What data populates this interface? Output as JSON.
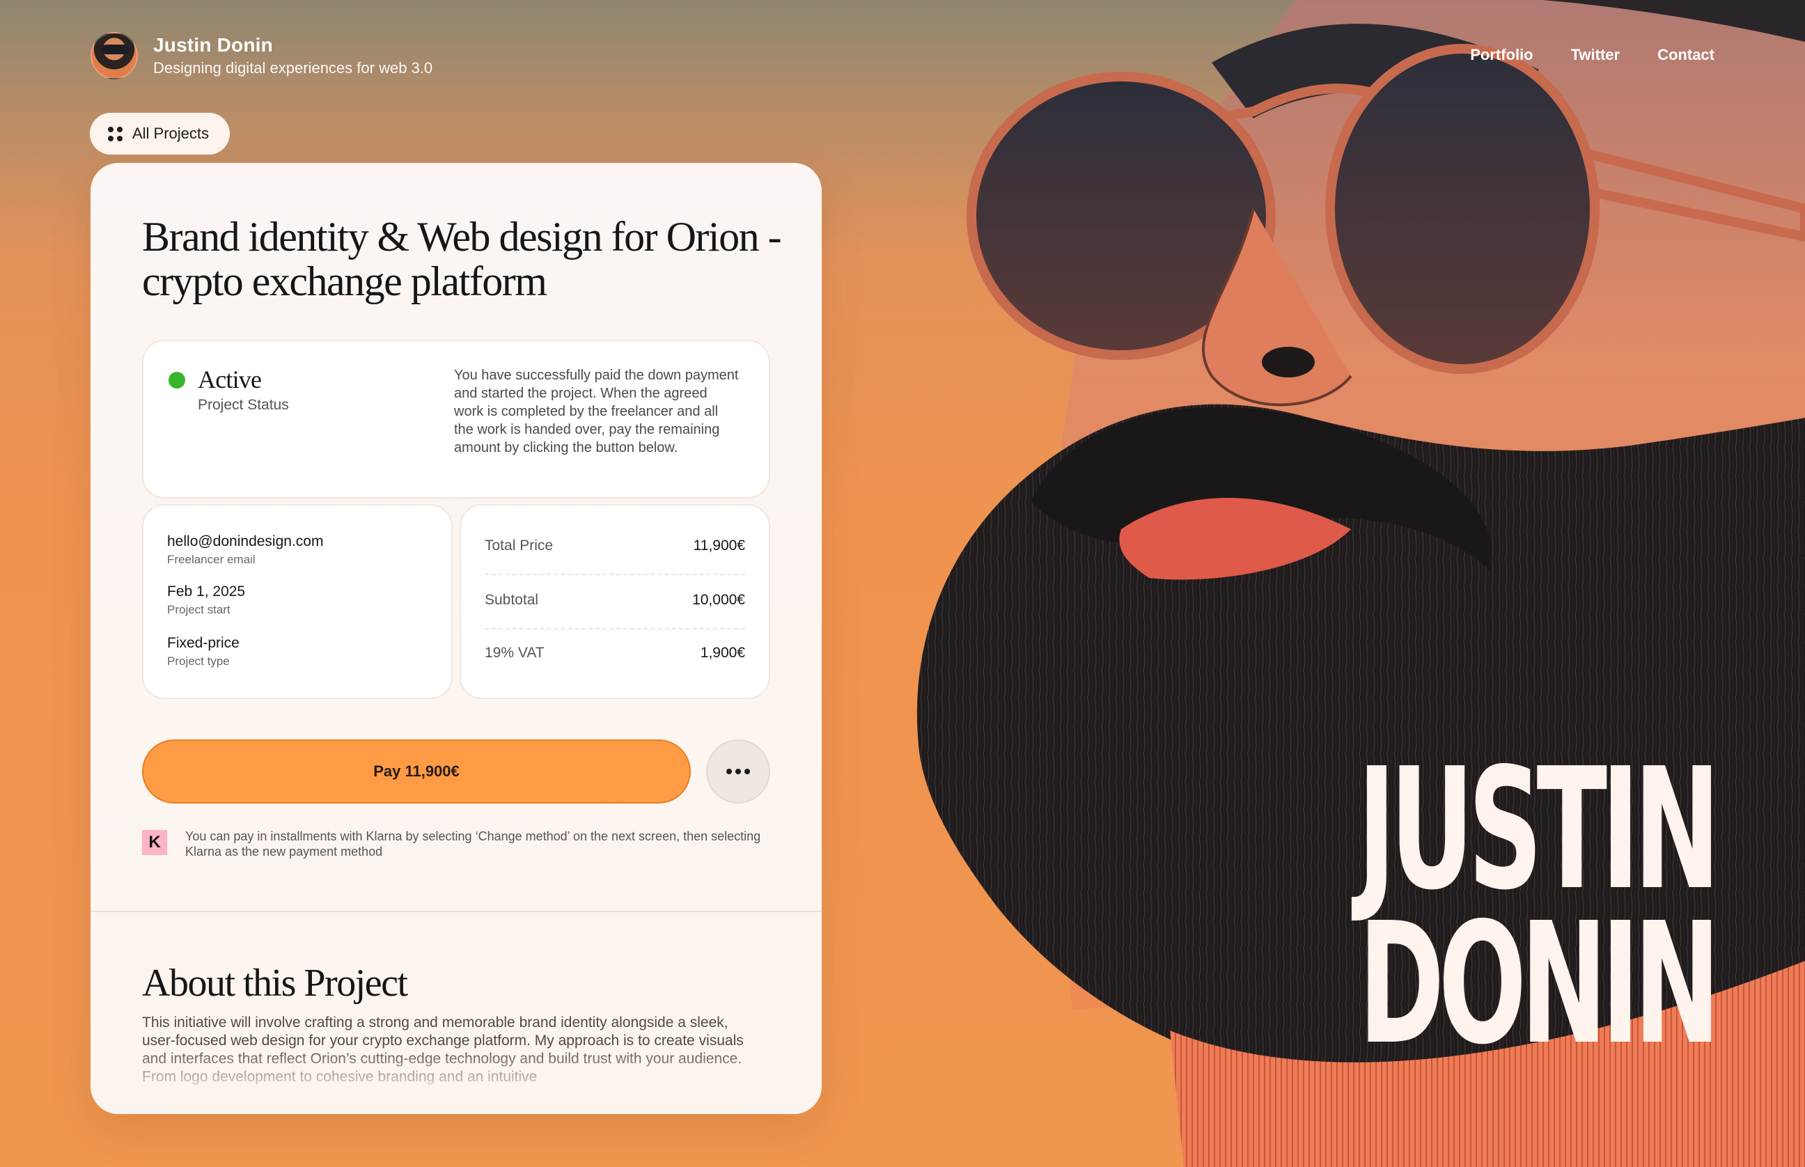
{
  "header": {
    "name": "Justin Donin",
    "tagline": "Designing digital experiences for web 3.0",
    "nav": [
      "Portfolio",
      "Twitter",
      "Contact"
    ]
  },
  "all_projects_label": "All Projects",
  "project": {
    "title": "Brand identity & Web design for Orion - crypto exchange platform",
    "status": {
      "value": "Active",
      "label": "Project Status",
      "color": "#36b52b",
      "description": "You have successfully paid the down payment and started the project. When the agreed work is completed by the freelancer and all the work is handed over, pay the remaining amount by clicking the button below."
    },
    "info": [
      {
        "value": "hello@donindesign.com",
        "label": "Freelancer email"
      },
      {
        "value": "Feb 1, 2025",
        "label": "Project start"
      },
      {
        "value": "Fixed-price",
        "label": "Project type"
      }
    ],
    "pricing": [
      {
        "label": "Total Price",
        "value": "11,900€"
      },
      {
        "label": "Subtotal",
        "value": "10,000€"
      },
      {
        "label": "19% VAT",
        "value": "1,900€"
      }
    ],
    "pay_button": "Pay 11,900€",
    "klarna_icon": "K",
    "klarna_note": "You can pay in installments with Klarna by selecting  ‘Change method’ on the next screen, then selecting Klarna as the new payment method"
  },
  "about": {
    "title": "About this Project",
    "body": "This initiative will involve crafting a strong and memorable brand identity alongside a sleek, user-focused web design for your crypto exchange platform. My approach is to create visuals and interfaces that reflect Orion’s cutting-edge technology and build trust with your audience. From logo development to cohesive branding and an intuitive"
  },
  "hero": {
    "line1": "JUSTIN",
    "line2": "DONIN"
  },
  "colors": {
    "accent": "#ff9b44",
    "status_active": "#36b52b",
    "card_bg": "#fbf6f3"
  }
}
